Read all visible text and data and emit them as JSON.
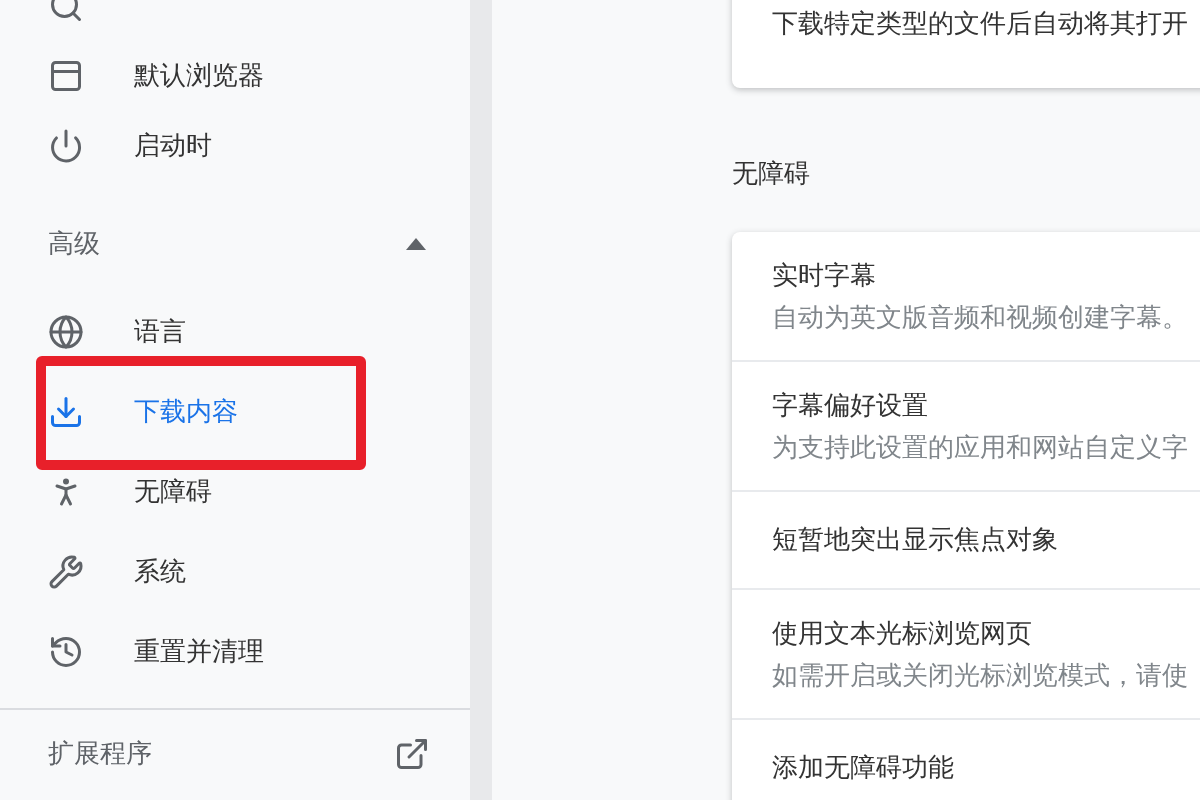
{
  "sidebar": {
    "items": [
      {
        "label": "默认浏览器",
        "selected": false
      },
      {
        "label": "启动时",
        "selected": false
      }
    ],
    "advanced": {
      "label": "高级",
      "expanded": true,
      "items": [
        {
          "label": "语言",
          "selected": false,
          "highlighted": false
        },
        {
          "label": "下载内容",
          "selected": true,
          "highlighted": true
        },
        {
          "label": "无障碍",
          "selected": false,
          "highlighted": false
        },
        {
          "label": "系统",
          "selected": false,
          "highlighted": false
        },
        {
          "label": "重置并清理",
          "selected": false,
          "highlighted": false
        }
      ]
    },
    "extensions": {
      "label": "扩展程序"
    }
  },
  "main": {
    "top_card": {
      "rows": [
        {
          "title": "下载特定类型的文件后自动将其打开"
        }
      ]
    },
    "section": {
      "title": "无障碍",
      "rows": [
        {
          "title": "实时字幕",
          "description": "自动为英文版音频和视频创建字幕。"
        },
        {
          "title": "字幕偏好设置",
          "description": "为支持此设置的应用和网站自定义字"
        },
        {
          "title": "短暂地突出显示焦点对象"
        },
        {
          "title": "使用文本光标浏览网页",
          "description": "如需开启或关闭光标浏览模式，请使"
        },
        {
          "title": "添加无障碍功能"
        }
      ]
    }
  }
}
